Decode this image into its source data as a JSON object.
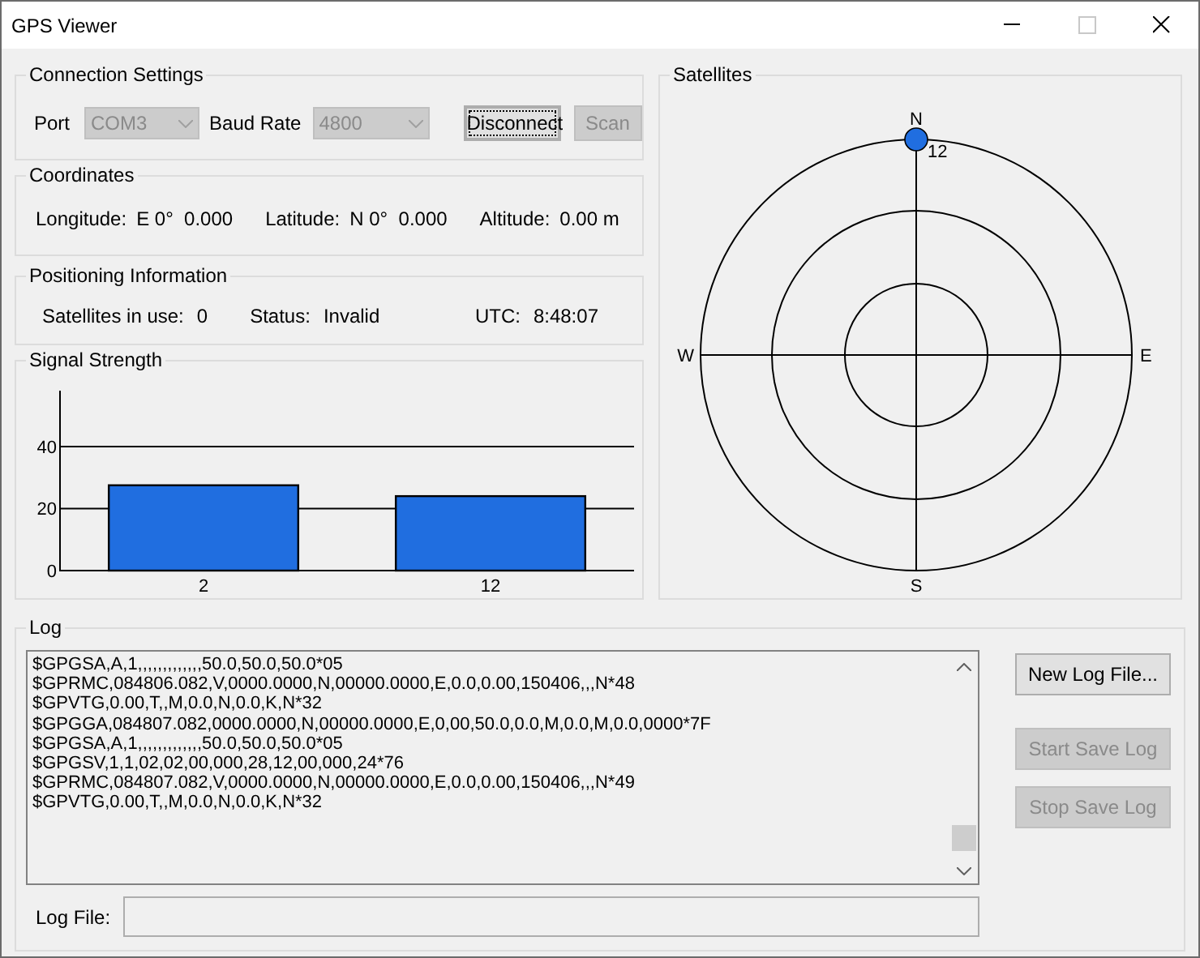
{
  "window": {
    "title": "GPS Viewer"
  },
  "connection_settings": {
    "title": "Connection Settings",
    "port_label": "Port",
    "port": {
      "value": "COM3",
      "disabled": true
    },
    "baud_label": "Baud Rate",
    "baud": {
      "value": "4800",
      "disabled": true
    },
    "buttons": [
      {
        "label": "Disconnect",
        "disabled": false,
        "focused": true
      },
      {
        "label": "Scan",
        "disabled": true,
        "focused": false
      }
    ]
  },
  "coordinates": {
    "title": "Coordinates",
    "fields": [
      {
        "label": "Longitude:",
        "value": "E 0°  0.000"
      },
      {
        "label": "Latitude:",
        "value": "N 0°  0.000"
      },
      {
        "label": "Altitude:",
        "value": "0.00 m"
      }
    ]
  },
  "positioning": {
    "title": "Positioning Information",
    "fields": [
      {
        "label": "Satellites in use:",
        "value": "0"
      },
      {
        "label": "Status:",
        "value": "Invalid"
      },
      {
        "label": "UTC:",
        "value": "8:48:07"
      }
    ]
  },
  "signal_strength": {
    "title": "Signal Strength",
    "chart_data": {
      "type": "bar",
      "categories": [
        "2",
        "12"
      ],
      "values": [
        27.5,
        24
      ],
      "ylim": [
        0,
        58
      ],
      "yticks": [
        0,
        20,
        40
      ]
    }
  },
  "satellites": {
    "title": "Satellites",
    "directions": [
      "N",
      "E",
      "S",
      "W"
    ],
    "items": [
      {
        "label": "12"
      }
    ]
  },
  "log": {
    "title": "Log",
    "lines": [
      "$GPGSA,A,1,,,,,,,,,,,,,50.0,50.0,50.0*05",
      "$GPRMC,084806.082,V,0000.0000,N,00000.0000,E,0.0,0.00,150406,,,N*48",
      "$GPVTG,0.00,T,,M,0.0,N,0.0,K,N*32",
      "$GPGGA,084807.082,0000.0000,N,00000.0000,E,0,00,50.0,0.0,M,0.0,M,0.0,0000*7F",
      "$GPGSA,A,1,,,,,,,,,,,,,50.0,50.0,50.0*05",
      "$GPGSV,1,1,02,02,00,000,28,12,00,000,24*76",
      "$GPRMC,084807.082,V,0000.0000,N,00000.0000,E,0.0,0.00,150406,,,N*49",
      "$GPVTG,0.00,T,,M,0.0,N,0.0,K,N*32"
    ],
    "buttons": [
      {
        "label": "New Log File...",
        "disabled": false
      },
      {
        "label": "Start Save Log",
        "disabled": true
      },
      {
        "label": "Stop Save Log",
        "disabled": true
      }
    ],
    "log_file_label": "Log File:"
  }
}
